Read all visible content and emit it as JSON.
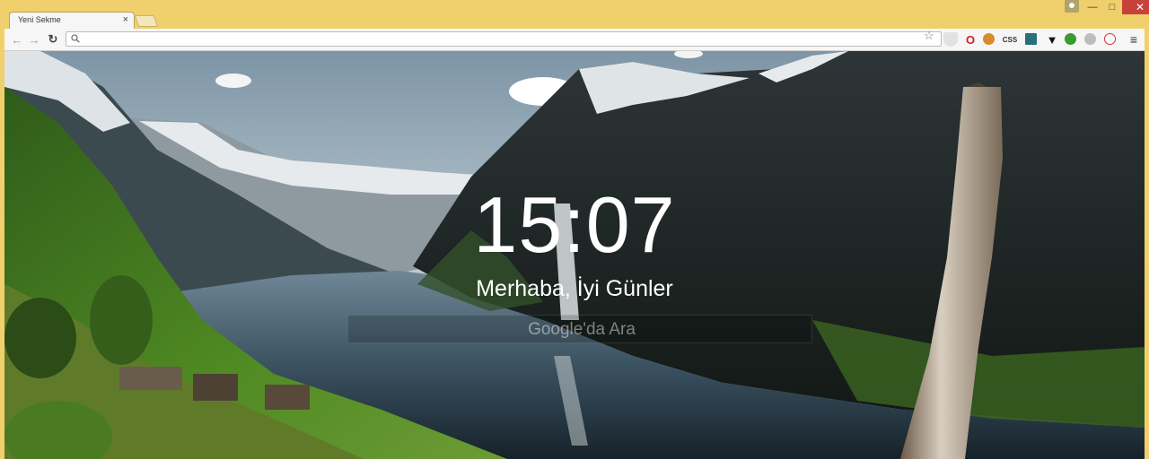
{
  "tab": {
    "title": "Yeni Sekme",
    "close": "×"
  },
  "window": {
    "minimize": "—",
    "maximize": "□",
    "close": "✕"
  },
  "toolbar": {
    "back": "←",
    "forward": "→",
    "reload": "↻",
    "address": {
      "value": "",
      "placeholder": ""
    },
    "star": "☆",
    "extensions": [
      {
        "name": "shield-extension-icon",
        "label": ""
      },
      {
        "name": "opera-extension-icon",
        "label": "O"
      },
      {
        "name": "cookie-extension-icon",
        "label": ""
      },
      {
        "name": "css-extension-icon",
        "label": "CSS"
      },
      {
        "name": "book-extension-icon",
        "label": ""
      },
      {
        "name": "ghost-extension-icon",
        "label": ""
      },
      {
        "name": "green-extension-icon",
        "label": ""
      },
      {
        "name": "grey-extension-icon",
        "label": ""
      },
      {
        "name": "ctrlq-extension-icon",
        "label": ""
      }
    ],
    "menu": "≡"
  },
  "page": {
    "clock": "15:07",
    "greeting": "Merhaba, İyi Günler",
    "search_placeholder": "Google'da Ara"
  },
  "colors": {
    "frame": "#efd06c",
    "close_button": "#c7413b"
  }
}
